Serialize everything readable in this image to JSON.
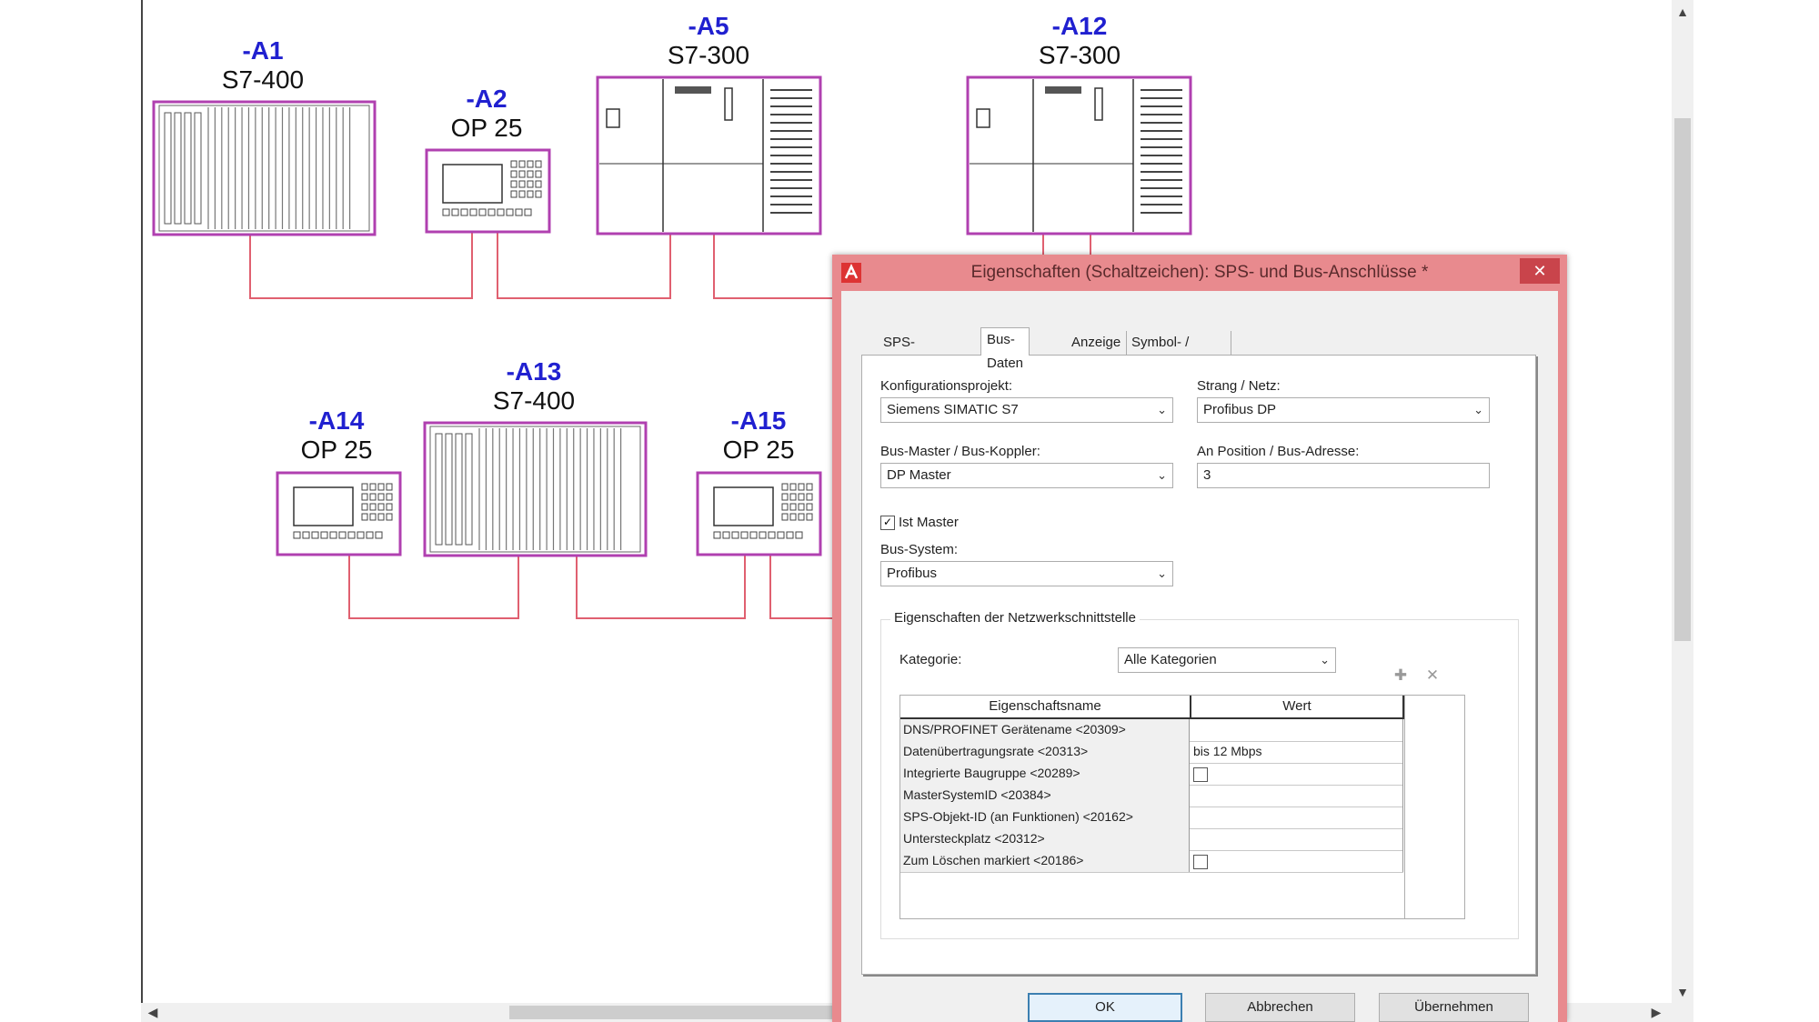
{
  "schematic": {
    "devices": [
      {
        "id": "-A1",
        "type": "S7-400"
      },
      {
        "id": "-A2",
        "type": "OP 25"
      },
      {
        "id": "-A5",
        "type": "S7-300"
      },
      {
        "id": "-A12",
        "type": "S7-300"
      },
      {
        "id": "-A13",
        "type": "S7-400"
      },
      {
        "id": "-A14",
        "type": "OP 25"
      },
      {
        "id": "-A15",
        "type": "OP 25"
      }
    ]
  },
  "colors": {
    "id_label": "#2020d0",
    "bus_line": "#e06070",
    "device_border": "#b040b0",
    "dialog_frame": "#e88a8e"
  },
  "dialog": {
    "title": "Eigenschaften (Schaltzeichen): SPS- und Bus-Anschlüsse *",
    "close_icon": "close-icon",
    "tabs": [
      "SPS-Anschluss",
      "Bus-Daten",
      "Anzeige",
      "Symbol- / Funktionsdaten"
    ],
    "active_tab": "Bus-Daten",
    "fields": {
      "konfig_label": "Konfigurationsprojekt:",
      "konfig_value": "Siemens SIMATIC S7",
      "strang_label": "Strang / Netz:",
      "strang_value": "Profibus DP",
      "busmaster_label": "Bus-Master / Bus-Koppler:",
      "busmaster_value": "DP Master",
      "position_label": "An Position / Bus-Adresse:",
      "position_value": "3",
      "ist_master_label": "Ist Master",
      "ist_master_checked": true,
      "bussystem_label": "Bus-System:",
      "bussystem_value": "Profibus"
    },
    "group": {
      "title": "Eigenschaften der Netzwerkschnittstelle",
      "kategorie_label": "Kategorie:",
      "kategorie_value": "Alle Kategorien",
      "columns": [
        "Eigenschaftsname",
        "Wert"
      ],
      "rows": [
        {
          "name": "DNS/PROFINET Gerätename <20309>",
          "value": "",
          "checkbox": false
        },
        {
          "name": "Datenübertragungsrate <20313>",
          "value": "bis 12 Mbps",
          "checkbox": false
        },
        {
          "name": "Integrierte Baugruppe <20289>",
          "value": "",
          "checkbox": true
        },
        {
          "name": "MasterSystemID <20384>",
          "value": "",
          "checkbox": false
        },
        {
          "name": "SPS-Objekt-ID (an Funktionen) <20162>",
          "value": "",
          "checkbox": false
        },
        {
          "name": "Untersteckplatz <20312>",
          "value": "",
          "checkbox": false
        },
        {
          "name": "Zum Löschen markiert <20186>",
          "value": "",
          "checkbox": true
        }
      ]
    },
    "buttons": {
      "ok": "OK",
      "cancel": "Abbrechen",
      "apply": "Übernehmen"
    }
  }
}
